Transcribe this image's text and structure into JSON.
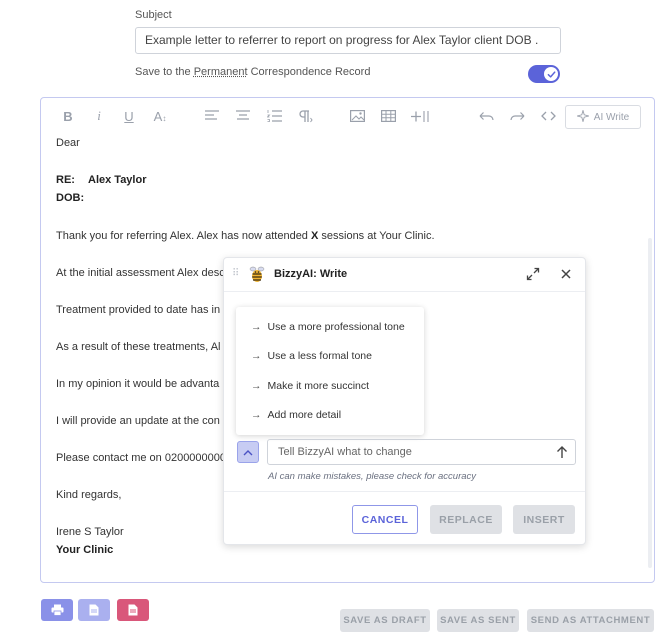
{
  "subject": {
    "label": "Subject",
    "value": "Example letter to referrer to report on progress for Alex Taylor client DOB ."
  },
  "save_record": {
    "label_before": "Save to the ",
    "label_link": "Permanent",
    "label_after": " Correspondence Record",
    "enabled": true,
    "accent_color": "#5b63d9"
  },
  "toolbar": {
    "bold": "B",
    "italic": "i",
    "underline": "U",
    "text_size": "A",
    "ai_write_label": "AI Write"
  },
  "letter": {
    "greeting": "Dear",
    "re_label": "RE:",
    "re_value": "Alex Taylor",
    "dob_label": "DOB:",
    "para1_before": "Thank you for referring Alex.  Alex has now attended ",
    "para1_bold": "X",
    "para1_after": " sessions at Your Clinic.",
    "para2": "At the initial assessment Alex desc",
    "para3": "Treatment provided to date has in",
    "para4": "As a result of these treatments, Al",
    "para5": "In my opinion it would be advanta",
    "para6": "I will provide an update at the con",
    "para7": "Please contact me on 0200000000",
    "closing": "Kind regards,",
    "signature_name": "Irene S Taylor",
    "signature_clinic": "Your Clinic"
  },
  "bizzy": {
    "title": "BizzyAI: Write",
    "suggestions": [
      "Use a more professional tone",
      "Use a less formal tone",
      "Make it more succinct",
      "Add more detail"
    ],
    "prompt_placeholder": "Tell BizzyAI what to change",
    "disclaimer": "AI can make mistakes, please check for accuracy",
    "cancel_label": "CANCEL",
    "replace_label": "REPLACE",
    "insert_label": "INSERT"
  },
  "actions": {
    "save_draft": "SAVE AS DRAFT",
    "save_sent": "SAVE AS SENT",
    "send_attachment": "SEND AS ATTACHMENT"
  },
  "icons": {
    "print": "printer-icon",
    "doc": "document-icon",
    "pdf": "pdf-icon"
  }
}
